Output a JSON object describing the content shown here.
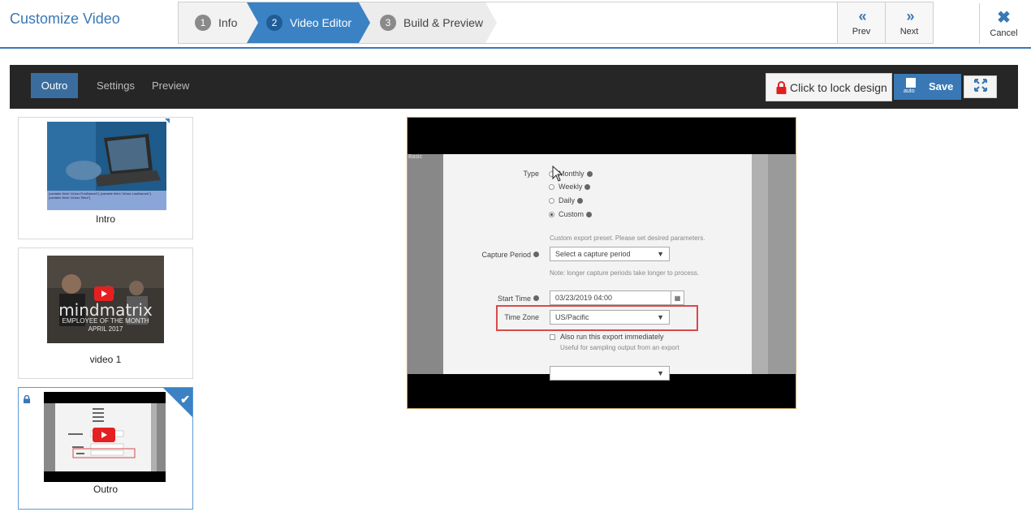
{
  "header": {
    "title": "Customize Video",
    "steps": [
      {
        "num": "1",
        "label": "Info"
      },
      {
        "num": "2",
        "label": "Video Editor"
      },
      {
        "num": "3",
        "label": "Build & Preview"
      }
    ],
    "prev_label": "Prev",
    "next_label": "Next",
    "cancel_label": "Cancel"
  },
  "toolbar": {
    "tabs": [
      "Outro",
      "Settings",
      "Preview"
    ],
    "active_tab": "Outro",
    "lock_label": "Click to lock design",
    "save_label": "Save",
    "auto_label": "auto"
  },
  "thumbnails": [
    {
      "label": "Intro",
      "overlay_text": "{variable field=\"#User.FirstName#\"} {variable field=\"#User.LastName#\"}",
      "overlay_text2": "{variable field=\"#User.Title#\"}"
    },
    {
      "label": "video 1",
      "brand": "mindmatrix",
      "caption1": "EMPLOYEE OF THE MONTH",
      "caption2": "APRIL 2017"
    },
    {
      "label": "Outro",
      "selected": true,
      "locked": true
    }
  ],
  "preview": {
    "corner_text": "Basic",
    "form": {
      "type_label": "Type",
      "type_options": [
        "Monthly",
        "Weekly",
        "Daily",
        "Custom"
      ],
      "selected_option": "Custom",
      "custom_hint": "Custom export preset. Please set desired parameters.",
      "capture_period_label": "Capture Period",
      "capture_period_value": "Select a capture period",
      "capture_note": "Note: longer capture periods take longer to process.",
      "start_time_label": "Start Time",
      "start_time_value": "03/23/2019 04:00",
      "time_zone_label": "Time Zone",
      "time_zone_value": "US/Pacific",
      "run_now_label": "Also run this export immediately",
      "run_now_hint": "Useful for sampling output from an export"
    }
  },
  "colors": {
    "brand_blue": "#3a78b5",
    "active_step": "#3a82c4",
    "toolbar_bg": "#262626",
    "lock_red": "#e02020"
  }
}
